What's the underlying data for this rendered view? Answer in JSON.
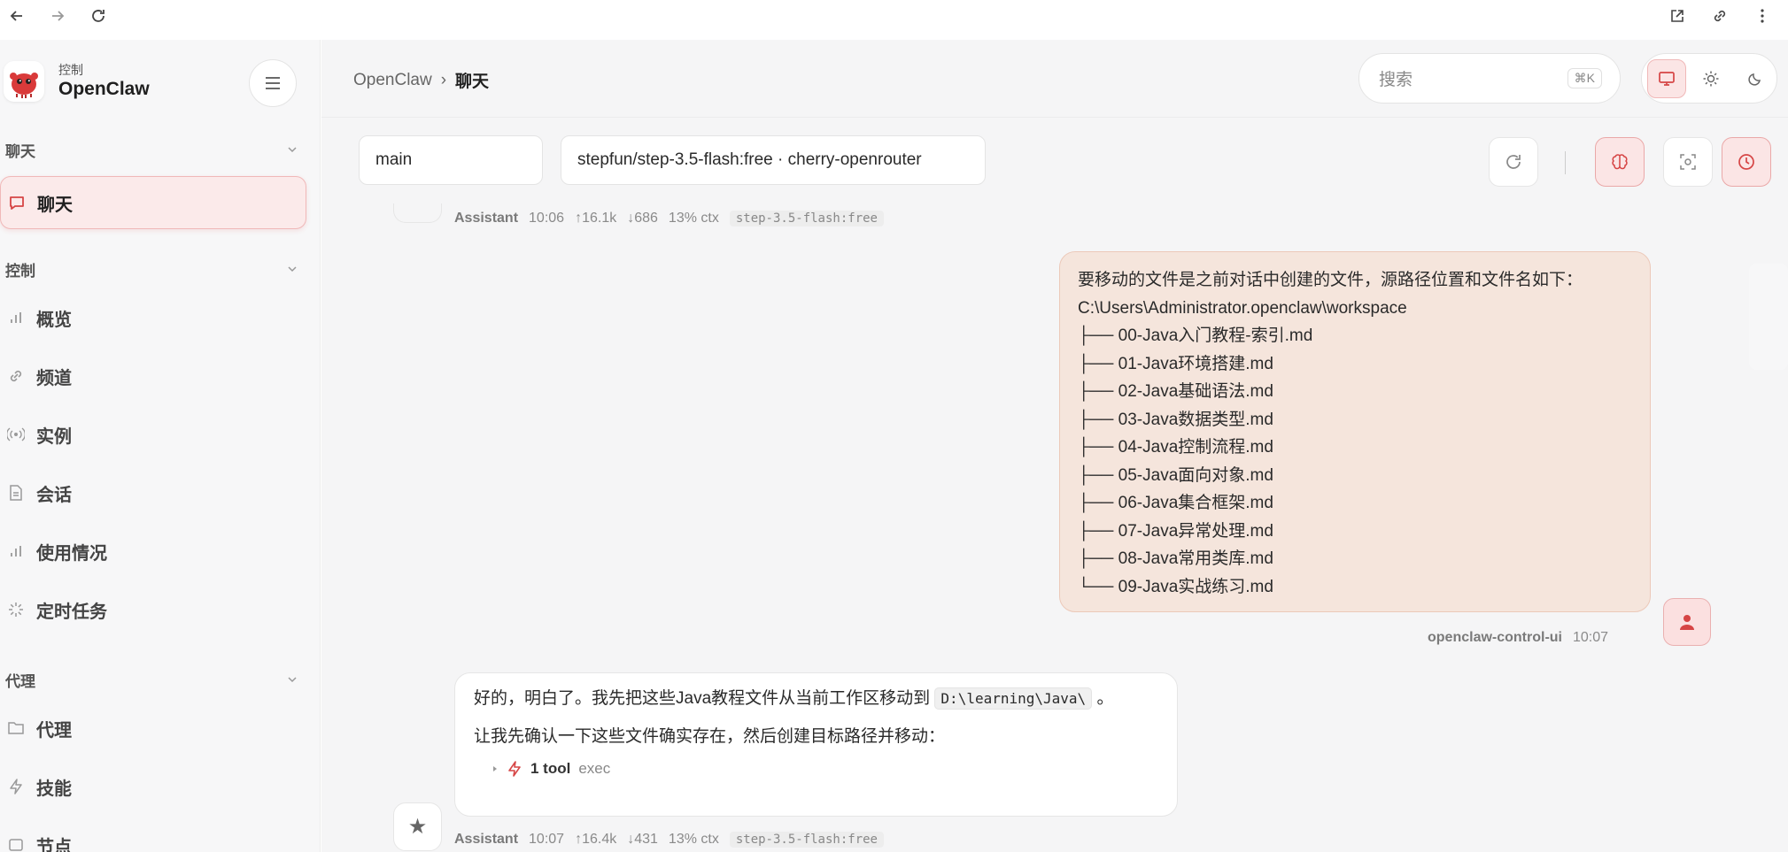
{
  "sidebar": {
    "brand_subtitle": "控制",
    "brand_title": "OpenClaw",
    "sections": [
      {
        "label": "聊天"
      },
      {
        "label": "控制"
      },
      {
        "label": "代理"
      }
    ],
    "items": [
      {
        "label": "聊天",
        "icon": "message-icon",
        "active": true
      },
      {
        "label": "概览",
        "icon": "bar-chart-icon"
      },
      {
        "label": "频道",
        "icon": "link-icon"
      },
      {
        "label": "实例",
        "icon": "broadcast-icon"
      },
      {
        "label": "会话",
        "icon": "document-icon"
      },
      {
        "label": "使用情况",
        "icon": "bar-chart-icon"
      },
      {
        "label": "定时任务",
        "icon": "loader-icon"
      },
      {
        "label": "代理",
        "icon": "folder-icon"
      },
      {
        "label": "技能",
        "icon": "bolt-icon"
      },
      {
        "label": "节点",
        "icon": "node-icon"
      }
    ]
  },
  "header": {
    "breadcrumb_root": "OpenClaw",
    "breadcrumb_sep": "›",
    "breadcrumb_current": "聊天",
    "search_placeholder": "搜索",
    "search_shortcut": "⌘K"
  },
  "controls": {
    "session_value": "main",
    "model_value": "stepfun/step-3.5-flash:free · cherry-openrouter"
  },
  "messages": {
    "prev_meta": {
      "who": "Assistant",
      "time": "10:06",
      "up": "↑16.1k",
      "down": "↓686",
      "ctx": "13% ctx",
      "model": "step-3.5-flash:free"
    },
    "user_lines": [
      "要移动的文件是之前对话中创建的文件，源路径位置和文件名如下：",
      "C:\\Users\\Administrator.openclaw\\workspace",
      "├── 00-Java入门教程-索引.md",
      "├── 01-Java环境搭建.md",
      "├── 02-Java基础语法.md",
      "├── 03-Java数据类型.md",
      "├── 04-Java控制流程.md",
      "├── 05-Java面向对象.md",
      "├── 06-Java集合框架.md",
      "├── 07-Java异常处理.md",
      "├── 08-Java常用类库.md",
      "└── 09-Java实战练习.md"
    ],
    "user_meta": {
      "who": "openclaw-control-ui",
      "time": "10:07"
    },
    "assistant": {
      "line1_pre": "好的，明白了。我先把这些Java教程文件从当前工作区移动到",
      "line1_code": "D:\\learning\\Java\\",
      "line1_post": "。",
      "line2": "让我先确认一下这些文件确实存在，然后创建目标路径并移动：",
      "tool_label": "1 tool",
      "tool_name": "exec"
    },
    "asst_meta": {
      "who": "Assistant",
      "time": "10:07",
      "up": "↑16.4k",
      "down": "↓431",
      "ctx": "13% ctx",
      "model": "step-3.5-flash:free"
    }
  },
  "colors": {
    "accent": "#d64545",
    "user_bubble": "#f5e5dc",
    "active_bg": "#fbeaea"
  }
}
